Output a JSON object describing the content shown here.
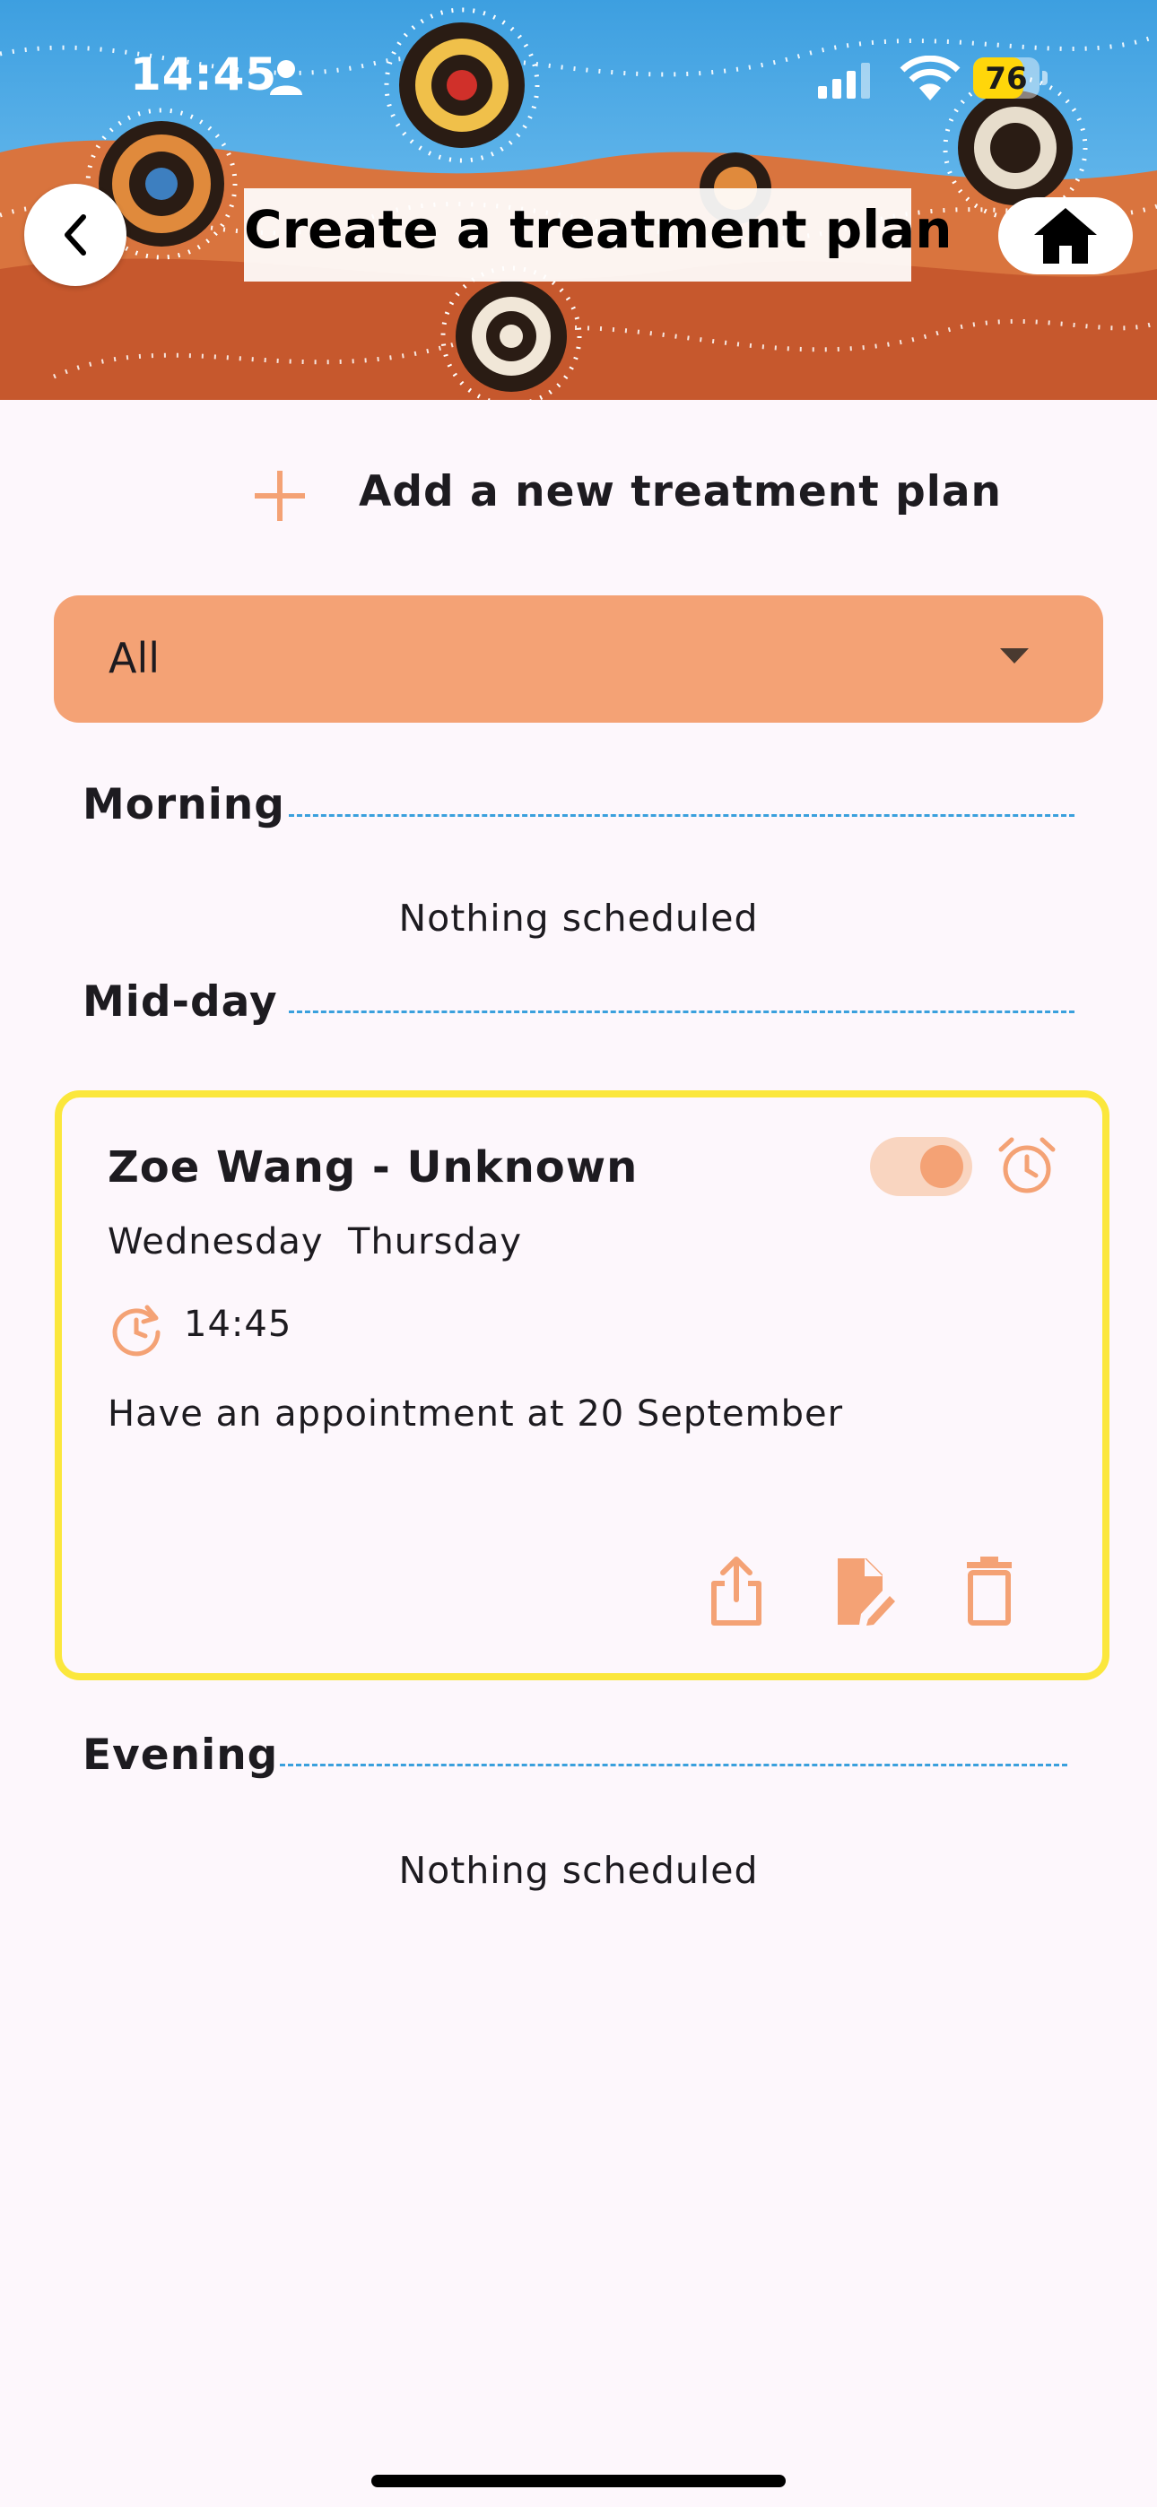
{
  "status_bar": {
    "time": "14:45",
    "battery_percent": 76,
    "battery_label": "76",
    "icons": [
      "person-icon",
      "cellular-signal-icon",
      "wifi-icon",
      "battery-icon"
    ]
  },
  "nav": {
    "title": "Create a treatment plan",
    "back_icon": "chevron-left-icon",
    "home_icon": "home-icon"
  },
  "add_plan": {
    "label": "Add a new treatment plan",
    "icon": "plus-icon"
  },
  "filter": {
    "selected": "All"
  },
  "sections": {
    "morning": {
      "label": "Morning",
      "empty_text": "Nothing scheduled"
    },
    "midday": {
      "label": "Mid-day"
    },
    "evening": {
      "label": "Evening",
      "empty_text": "Nothing scheduled"
    }
  },
  "plan_card": {
    "title": "Zoe Wang - Unknown",
    "days": "Wednesday  Thursday",
    "time": "14:45",
    "note": "Have an appointment at 20 September",
    "enabled": true,
    "actions": [
      "share-icon",
      "edit-icon",
      "delete-icon"
    ]
  },
  "colors": {
    "accent": "#f4a275",
    "card_border": "#fbe73c",
    "divider": "#3aa0dd",
    "background": "#fdf7fc"
  }
}
